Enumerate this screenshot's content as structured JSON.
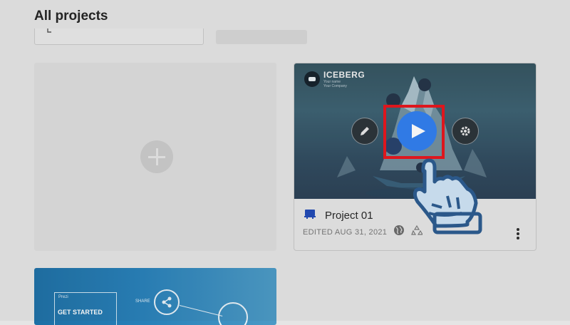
{
  "page": {
    "title": "All projects"
  },
  "project": {
    "title": "Project 01",
    "edited": "EDITED AUG 31, 2021",
    "thumbnail": {
      "brand": "ICEBERG",
      "sub1": "Your name",
      "sub2": "Your Company"
    },
    "play_color": "#2f7ef0",
    "highlight_color": "#e8141b"
  },
  "icons": {
    "search": "search-icon",
    "plus": "plus-icon",
    "edit": "pencil-icon",
    "play": "play-icon",
    "settings": "gear-icon",
    "globe": "globe-icon",
    "recycle": "recycle-icon",
    "more": "more-vertical-icon",
    "hand": "hand-pointer-icon"
  },
  "template_card": {
    "brand": "Prezi",
    "title": "GET STARTED",
    "share_label": "SHARE"
  }
}
